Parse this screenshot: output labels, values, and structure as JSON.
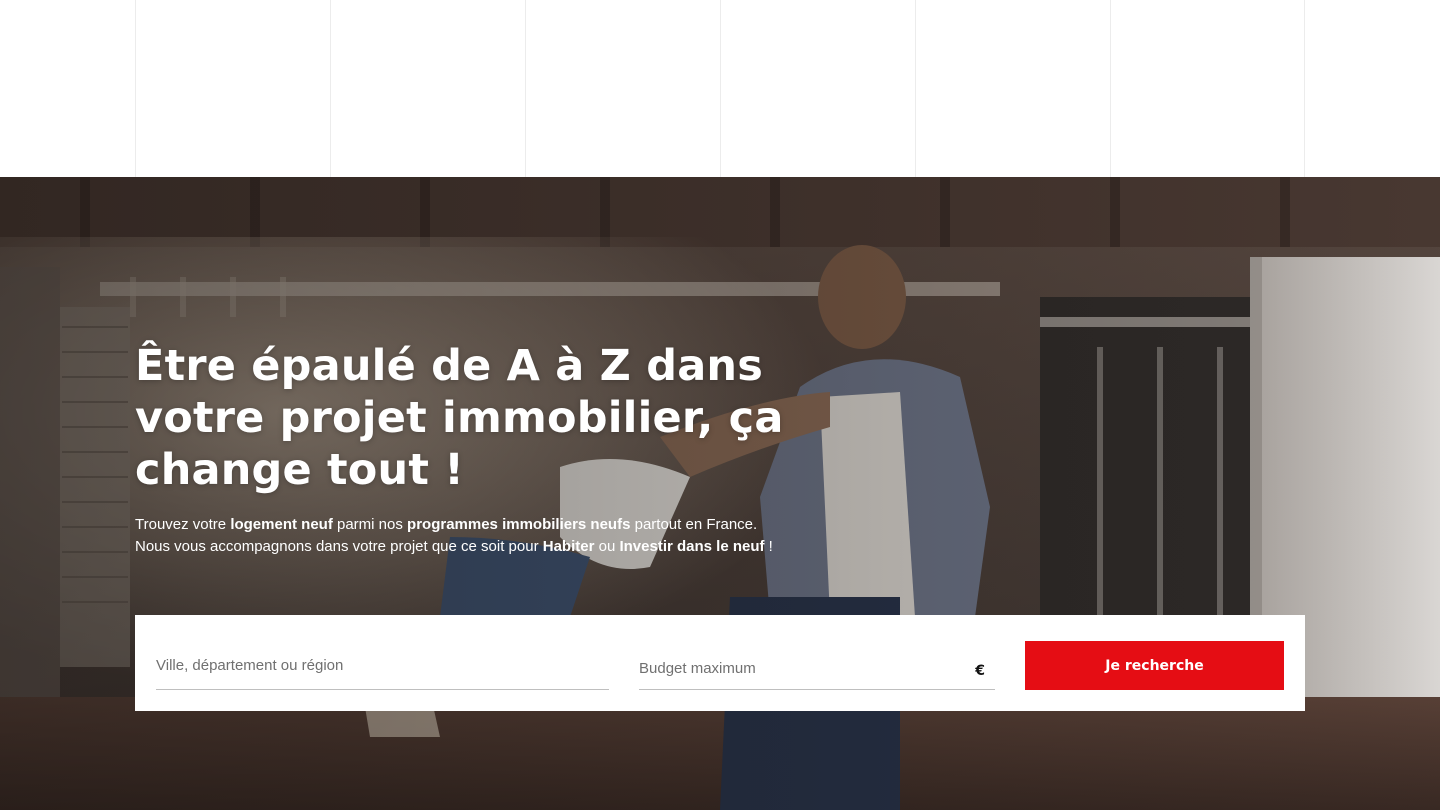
{
  "hero": {
    "headline": "Être épaulé de A à Z dans votre projet immobilier, ça change tout !",
    "subtext": {
      "line1": {
        "t1": "Trouvez votre ",
        "b1": "logement neuf",
        "t2": " parmi nos ",
        "b2": "programmes immobiliers neufs",
        "t3": " partout en France."
      },
      "line2": {
        "t1": "Nous vous accompagnons dans votre projet que ce soit pour ",
        "b1": "Habiter",
        "t2": " ou ",
        "b2": "Investir dans le neuf",
        "t3": " !"
      }
    },
    "image": "happy-father-swinging-child-photo"
  },
  "search": {
    "location_placeholder": "Ville, département ou région",
    "budget_placeholder": "Budget maximum",
    "currency_symbol": "€",
    "submit_label": "Je recherche"
  },
  "colors": {
    "accent": "#e50d14",
    "panel": "#ffffff",
    "text_on_hero": "#ffffff"
  }
}
